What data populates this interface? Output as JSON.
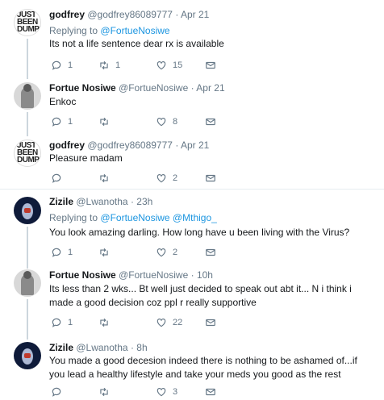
{
  "tweets": [
    {
      "name": "godfrey",
      "handle": "@godfrey86089777",
      "dot": "·",
      "time": "Apr 21",
      "replying_prefix": "Replying to",
      "replying_to": "@FortueNosiwe",
      "avatar_text": "JUST BEEN DUMPE",
      "text": "Its not a life sentence dear rx is available",
      "replies": "1",
      "retweets": "1",
      "likes": "15"
    },
    {
      "name": "Fortue Nosiwe",
      "handle": "@FortueNosiwe",
      "dot": "·",
      "time": "Apr 21",
      "text": "Enkoc",
      "replies": "1",
      "retweets": "",
      "likes": "8"
    },
    {
      "name": "godfrey",
      "handle": "@godfrey86089777",
      "dot": "·",
      "time": "Apr 21",
      "avatar_text": "JUST BEEN DUMPE",
      "text": "Pleasure madam",
      "replies": "",
      "retweets": "",
      "likes": "2"
    },
    {
      "name": "Zizile",
      "handle": "@Lwanotha",
      "dot": "·",
      "time": "23h",
      "replying_prefix": "Replying to",
      "replying_to": "@FortueNosiwe @Mthigo_",
      "text": "You look amazing darling. How long have u been living with the Virus?",
      "replies": "1",
      "retweets": "",
      "likes": "2"
    },
    {
      "name": "Fortue Nosiwe",
      "handle": "@FortueNosiwe",
      "dot": "·",
      "time": "10h",
      "text": "Its less than 2 wks...  Bt well just decided to speak out abt it...  N i think i made a good decision coz ppl r really supportive",
      "replies": "1",
      "retweets": "",
      "likes": "22"
    },
    {
      "name": "Zizile",
      "handle": "@Lwanotha",
      "dot": "·",
      "time": "8h",
      "text": "You made a good decesion indeed there is nothing to be ashamed of...if you lead a healthy lifestyle and take your meds you good as the rest",
      "replies": "",
      "retweets": "",
      "likes": "3"
    }
  ]
}
